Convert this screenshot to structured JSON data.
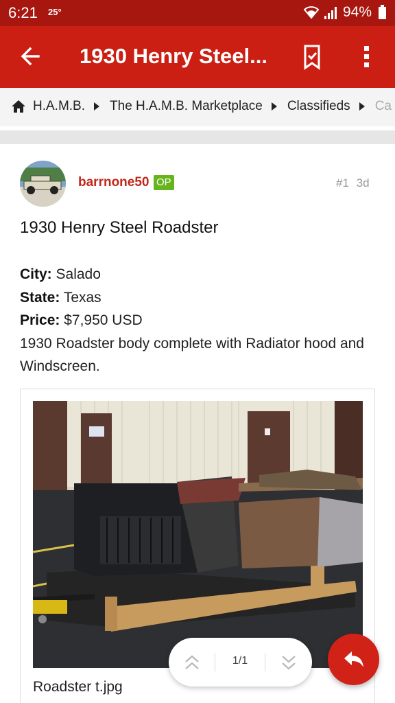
{
  "status_bar": {
    "time": "6:21",
    "temperature": "25°",
    "battery": "94%",
    "icons": [
      "wifi-icon",
      "signal-icon",
      "battery-icon"
    ],
    "color": "#a8170f"
  },
  "app_bar": {
    "title": "1930 Henry Steel...",
    "icons": [
      "back-arrow-icon",
      "bookmark-icon",
      "more-vertical-icon"
    ],
    "color": "#cc1f14"
  },
  "breadcrumb": {
    "items": [
      "H.A.M.B.",
      "The H.A.M.B. Marketplace",
      "Classifieds",
      "Ca"
    ],
    "icons": [
      "home-icon",
      "caret-right-icon"
    ]
  },
  "post": {
    "username": "barrnone50",
    "badge": "OP",
    "number": "#1",
    "age": "3d",
    "title": "1930 Henry Steel Roadster",
    "fields": [
      {
        "label": "City:",
        "value": "Salado"
      },
      {
        "label": "State:",
        "value": "Texas"
      },
      {
        "label": "Price:",
        "value": "$7,950 USD"
      }
    ],
    "description": "1930 Roadster body complete with Radiator hood and Windscreen.",
    "attachment": {
      "filename": "Roadster t.jpg"
    },
    "colors": {
      "username": "#c0281a",
      "badge": "#67b51c"
    }
  },
  "pager": {
    "text": "1/1",
    "icons": [
      "double-chevron-up-icon",
      "double-chevron-down-icon"
    ]
  },
  "fab": {
    "icon": "reply-icon",
    "color": "#d02216"
  }
}
